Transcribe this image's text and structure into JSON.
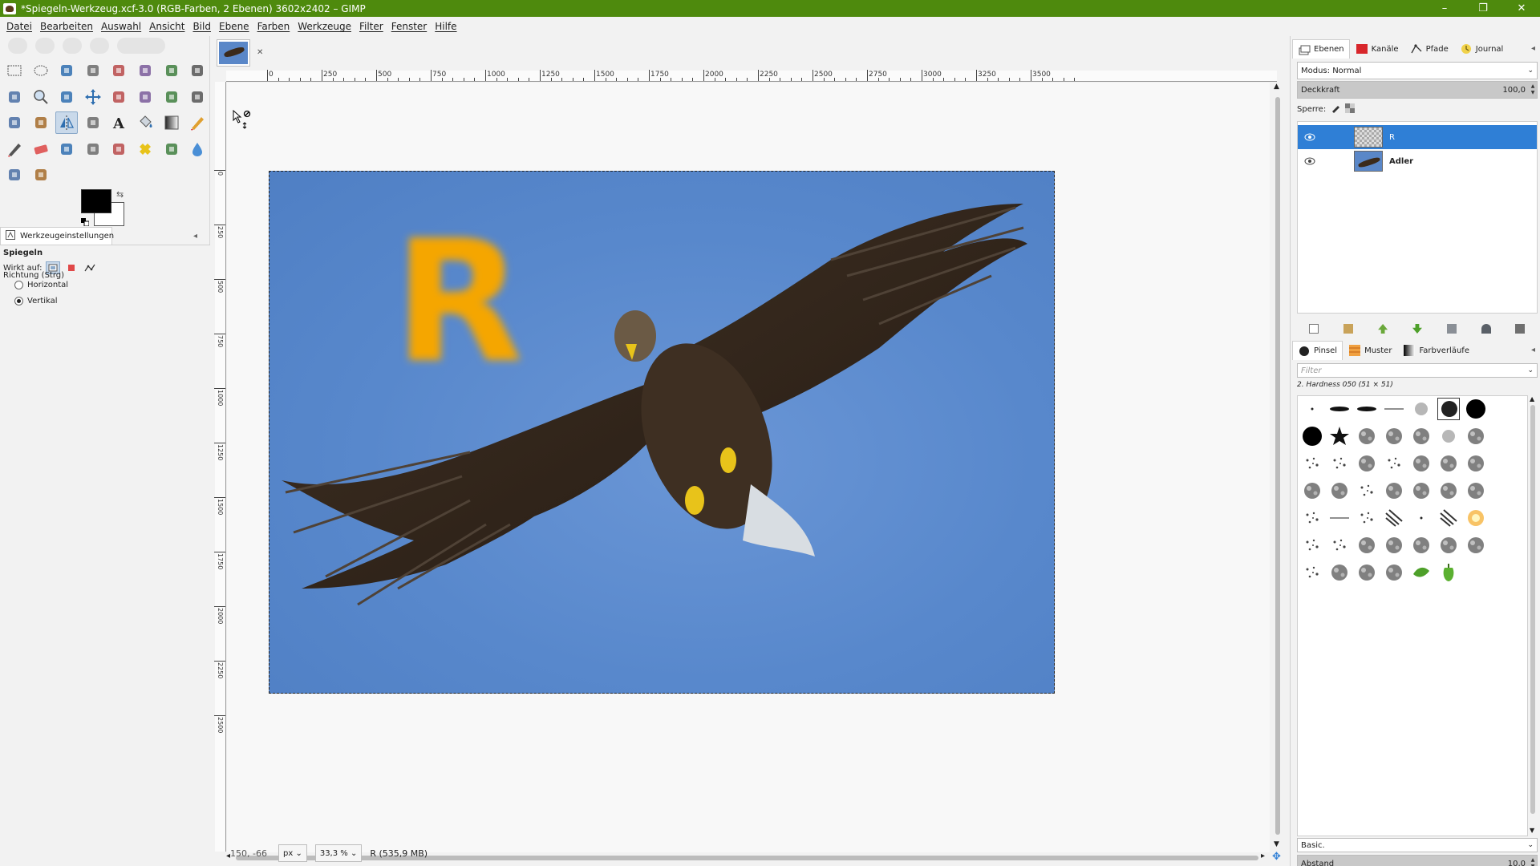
{
  "window": {
    "title": "*Spiegeln-Werkzeug.xcf-3.0 (RGB-Farben, 2 Ebenen) 3602x2402 – GIMP",
    "controls": [
      "–",
      "❐",
      "✕"
    ]
  },
  "menu": [
    "Datei",
    "Bearbeiten",
    "Auswahl",
    "Ansicht",
    "Bild",
    "Ebene",
    "Farben",
    "Werkzeuge",
    "Filter",
    "Fenster",
    "Hilfe"
  ],
  "toolbox": {
    "tools": [
      "rect-select-icon",
      "ellipse-select-icon",
      "free-select-icon",
      "fuzzy-select-icon",
      "by-color-select-icon",
      "scissors-select-icon",
      "foreground-select-icon",
      "paths-icon",
      "color-picker-icon",
      "zoom-icon",
      "measure-icon",
      "move-icon",
      "alignment-icon",
      "crop-icon",
      "unified-transform-icon",
      "rotate-icon",
      "scale-icon",
      "perspective-icon",
      "flip-icon",
      "cage-transform-icon",
      "text-icon",
      "bucket-fill-icon",
      "gradient-icon",
      "pencil-icon",
      "paintbrush-icon",
      "eraser-icon",
      "airbrush-icon",
      "ink-icon",
      "clone-icon",
      "heal-icon",
      "perspective-clone-icon",
      "blur-icon",
      "smudge-icon",
      "dodge-burn-icon"
    ],
    "active_tool": "flip-icon",
    "options_tab_label": "Werkzeugeinstellungen",
    "options": {
      "tool_name": "Spiegeln",
      "affects_label": "Wirkt auf:",
      "direction_label": "Richtung (Strg)",
      "horizontal_label": "Horizontal",
      "vertical_label": "Vertikal",
      "selected_direction": "Vertikal"
    }
  },
  "canvas": {
    "ruler_labels": [
      "0",
      "250",
      "500",
      "750",
      "1000",
      "1250",
      "1500",
      "1750",
      "2000",
      "2250",
      "2500",
      "2750",
      "3000",
      "3250",
      "3500"
    ],
    "vruler_labels": [
      "0",
      "250",
      "500",
      "750",
      "1000",
      "1250",
      "1500",
      "1750",
      "2000",
      "2250",
      "2500"
    ],
    "layer_text": "R",
    "text_color": "#f5a600",
    "sky_color": "#5888cc"
  },
  "status": {
    "coords": "150, -66",
    "unit": "px",
    "zoom": "33,3 %",
    "info": "R (535,9 MB)"
  },
  "dock": {
    "tabs_top": [
      "Ebenen",
      "Kanäle",
      "Pfade",
      "Journal"
    ],
    "mode_label": "Modus: Normal",
    "opacity_label": "Deckkraft",
    "opacity_value": "100,0",
    "lock_label": "Sperre:",
    "layers": [
      {
        "name": "R",
        "visible": true,
        "selected": true
      },
      {
        "name": "Adler",
        "visible": true,
        "selected": false
      }
    ],
    "tabs_bottom": [
      "Pinsel",
      "Muster",
      "Farbverläufe"
    ],
    "filter_placeholder": "Filter",
    "brush_selected": "2. Hardness 050 (51 × 51)",
    "preset": "Basic.",
    "spacing_label": "Abstand",
    "spacing_value": "10,0"
  },
  "colors": {
    "titlebar": "#4e8a0d",
    "selection": "#2f7fd6"
  }
}
